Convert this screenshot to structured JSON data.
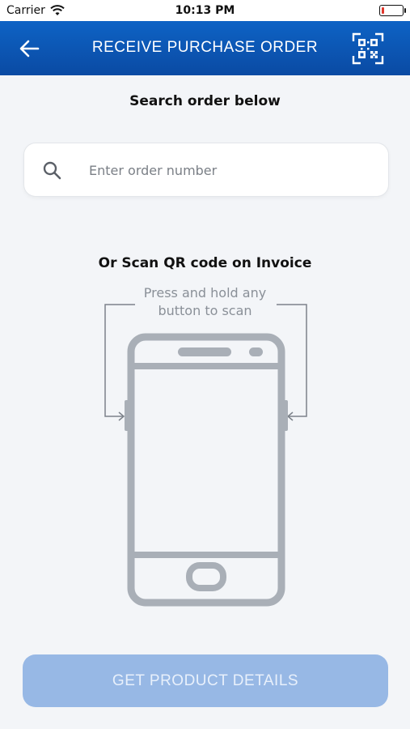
{
  "status_bar": {
    "carrier": "Carrier",
    "time": "10:13 PM",
    "wifi_icon": "wifi-icon",
    "battery_icon": "battery-low-icon",
    "battery_level_color": "#e0372c"
  },
  "header": {
    "title": "RECEIVE PURCHASE ORDER",
    "back_icon": "arrow-left-icon",
    "scan_icon": "qr-code-scan-icon",
    "background_color": "#0b55b4"
  },
  "search": {
    "heading": "Search order below",
    "placeholder": "Enter order number",
    "value": "",
    "icon": "search-icon"
  },
  "scan": {
    "heading": "Or Scan QR code on Invoice",
    "hint_line1": "Press and hold any",
    "hint_line2": "button to scan",
    "illustration": "phone-side-buttons-illustration"
  },
  "footer": {
    "button_label": "GET PRODUCT DETAILS",
    "button_state": "disabled",
    "button_color": "#97b8e5"
  }
}
